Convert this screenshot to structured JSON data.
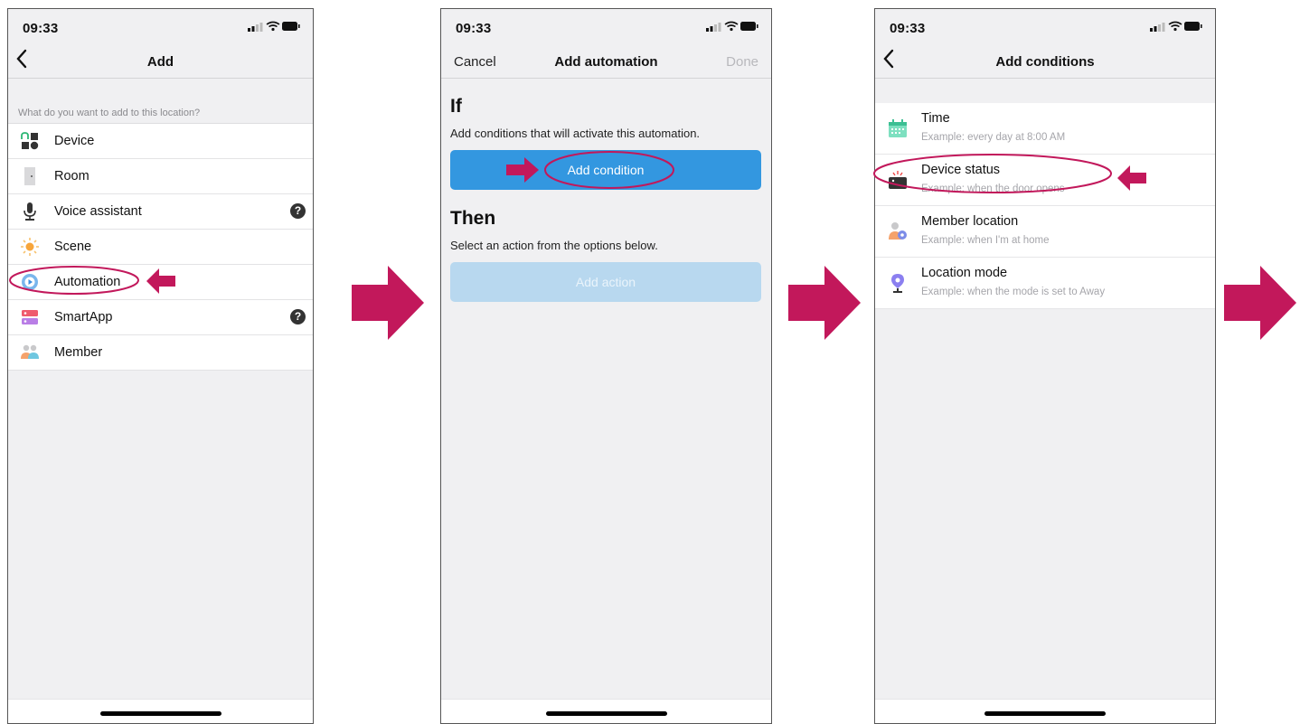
{
  "status": {
    "time": "09:33"
  },
  "panel1": {
    "title": "Add",
    "section_header": "What do you want to add to this location?",
    "items": [
      {
        "label": "Device",
        "icon": "device-icon"
      },
      {
        "label": "Room",
        "icon": "room-icon"
      },
      {
        "label": "Voice assistant",
        "icon": "microphone-icon",
        "help": "?"
      },
      {
        "label": "Scene",
        "icon": "scene-sun-icon"
      },
      {
        "label": "Automation",
        "icon": "automation-icon"
      },
      {
        "label": "SmartApp",
        "icon": "smartapp-icon",
        "help": "?"
      },
      {
        "label": "Member",
        "icon": "member-icon"
      }
    ]
  },
  "panel2": {
    "cancel": "Cancel",
    "title": "Add automation",
    "done": "Done",
    "if_heading": "If",
    "if_desc": "Add conditions that will activate this automation.",
    "add_condition": "Add condition",
    "then_heading": "Then",
    "then_desc": "Select an action from the options below.",
    "add_action": "Add action"
  },
  "panel3": {
    "title": "Add conditions",
    "items": [
      {
        "title": "Time",
        "subtitle": "Example: every day at 8:00 AM",
        "icon": "calendar-icon"
      },
      {
        "title": "Device status",
        "subtitle": "Example: when the door opens",
        "icon": "device-status-icon"
      },
      {
        "title": "Member location",
        "subtitle": "Example: when I'm at home",
        "icon": "member-location-icon"
      },
      {
        "title": "Location mode",
        "subtitle": "Example: when the mode is set to Away",
        "icon": "location-pin-icon"
      }
    ]
  },
  "colors": {
    "accent": "#3397e0",
    "annotation": "#c2185b",
    "disabled_button": "#b8d8ef"
  }
}
